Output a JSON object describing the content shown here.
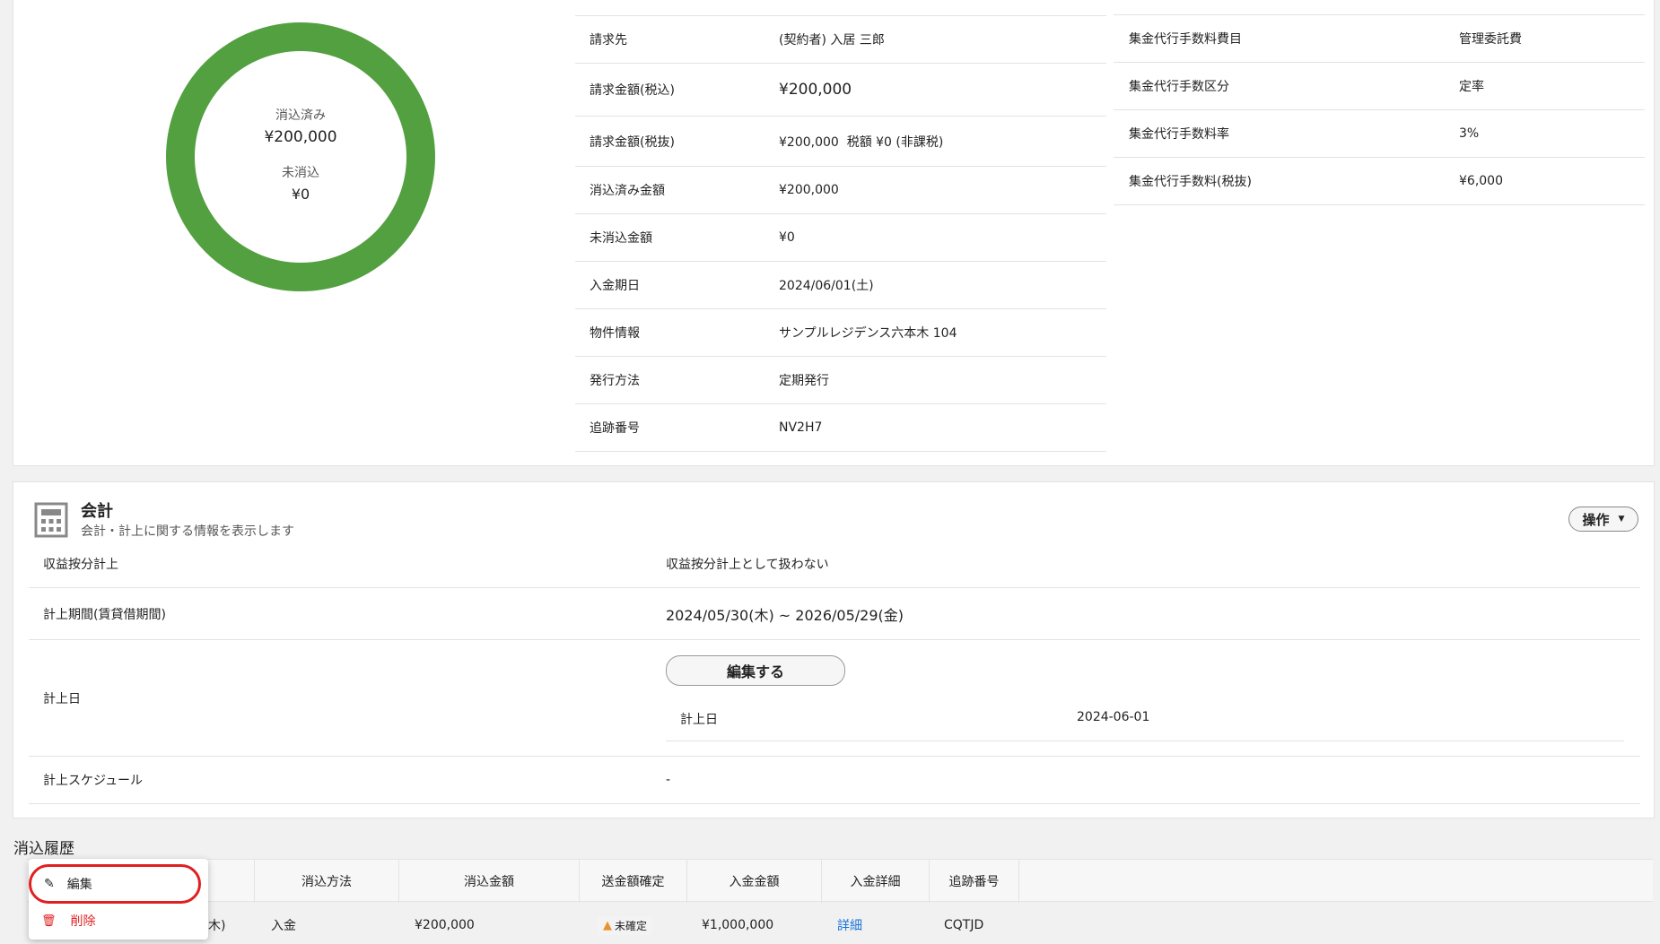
{
  "invoice": {
    "donut": {
      "cleared_label": "消込済み",
      "cleared_value": "¥200,000",
      "uncleared_label": "未消込",
      "uncleared_value": "¥0",
      "color": "#52a03f"
    },
    "middle_rows": [
      {
        "label": "請求先",
        "value": "(契約者) 入居 三郎"
      },
      {
        "label": "請求金額(税込)",
        "value": "¥200,000"
      },
      {
        "label": "請求金額(税抜)",
        "value": "¥200,000  税額 ¥0 (非課税)"
      },
      {
        "label": "消込済み金額",
        "value": "¥200,000"
      },
      {
        "label": "未消込金額",
        "value": "¥0"
      },
      {
        "label": "入金期日",
        "value": "2024/06/01(土)"
      },
      {
        "label": "物件情報",
        "value": "サンプルレジデンス六本木 104"
      },
      {
        "label": "発行方法",
        "value": "定期発行"
      },
      {
        "label": "追跡番号",
        "value": "NV2H7"
      }
    ],
    "right_rows": [
      {
        "label": "集金代行手数料費目",
        "value": "管理委託費"
      },
      {
        "label": "集金代行手数区分",
        "value": "定率"
      },
      {
        "label": "集金代行手数料率",
        "value": "3%"
      },
      {
        "label": "集金代行手数料(税抜)",
        "value": "¥6,000"
      }
    ]
  },
  "accounting": {
    "title": "会計",
    "subtitle": "会計・計上に関する情報を表示します",
    "ops_button": "操作",
    "rows": {
      "revenue_label": "収益按分計上",
      "revenue_value": "収益按分計上として扱わない",
      "period_label": "計上期間(賃貸借期間)",
      "period_value": "2024/05/30(木) ~ 2026/05/29(金)",
      "date_label": "計上日",
      "edit_button": "編集する",
      "inner_date_label": "計上日",
      "inner_date_value": "2024-06-01",
      "schedule_label": "計上スケジュール",
      "schedule_value": "-"
    }
  },
  "history": {
    "title": "消込履歴",
    "headers": [
      "消込方法",
      "消込金額",
      "送金額確定",
      "入金金額",
      "入金詳細",
      "追跡番号"
    ],
    "row": {
      "date_tail": "木)",
      "method": "入金",
      "amount": "¥200,000",
      "confirm": "未確定",
      "deposit": "¥1,000,000",
      "detail": "詳細",
      "tracking": "CQTJD"
    },
    "menu": {
      "edit": "編集",
      "delete": "削除"
    }
  }
}
